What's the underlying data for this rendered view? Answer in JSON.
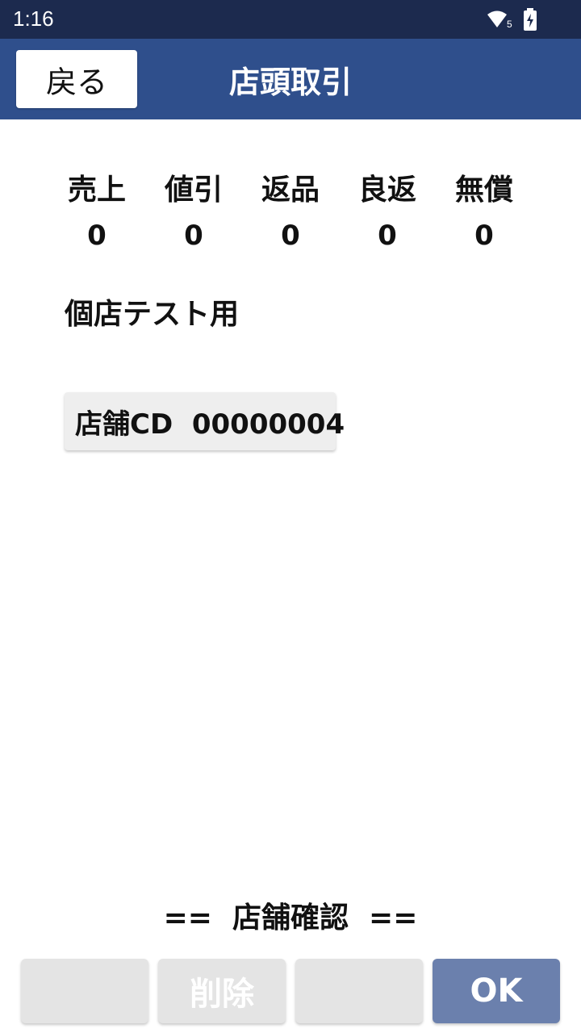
{
  "status_bar": {
    "time": "1:16",
    "wifi_badge": "5",
    "wifi_icon": "wifi-icon",
    "battery_icon": "battery-charging-icon"
  },
  "app_bar": {
    "back_label": "戻る",
    "title": "店頭取引",
    "background": "#2f4f8c"
  },
  "stats": [
    {
      "label": "売上",
      "value": "0"
    },
    {
      "label": "値引",
      "value": "0"
    },
    {
      "label": "返品",
      "value": "0"
    },
    {
      "label": "良返",
      "value": "0"
    },
    {
      "label": "無償",
      "value": "0"
    }
  ],
  "store": {
    "name": "個店テスト用",
    "code_label": "店舗CD  00000004"
  },
  "confirm_text": "==  店舗確認  ==",
  "bottom_buttons": [
    {
      "label": ""
    },
    {
      "label": "削除"
    },
    {
      "label": ""
    },
    {
      "label": "OK",
      "color": "#6b80ad"
    }
  ]
}
